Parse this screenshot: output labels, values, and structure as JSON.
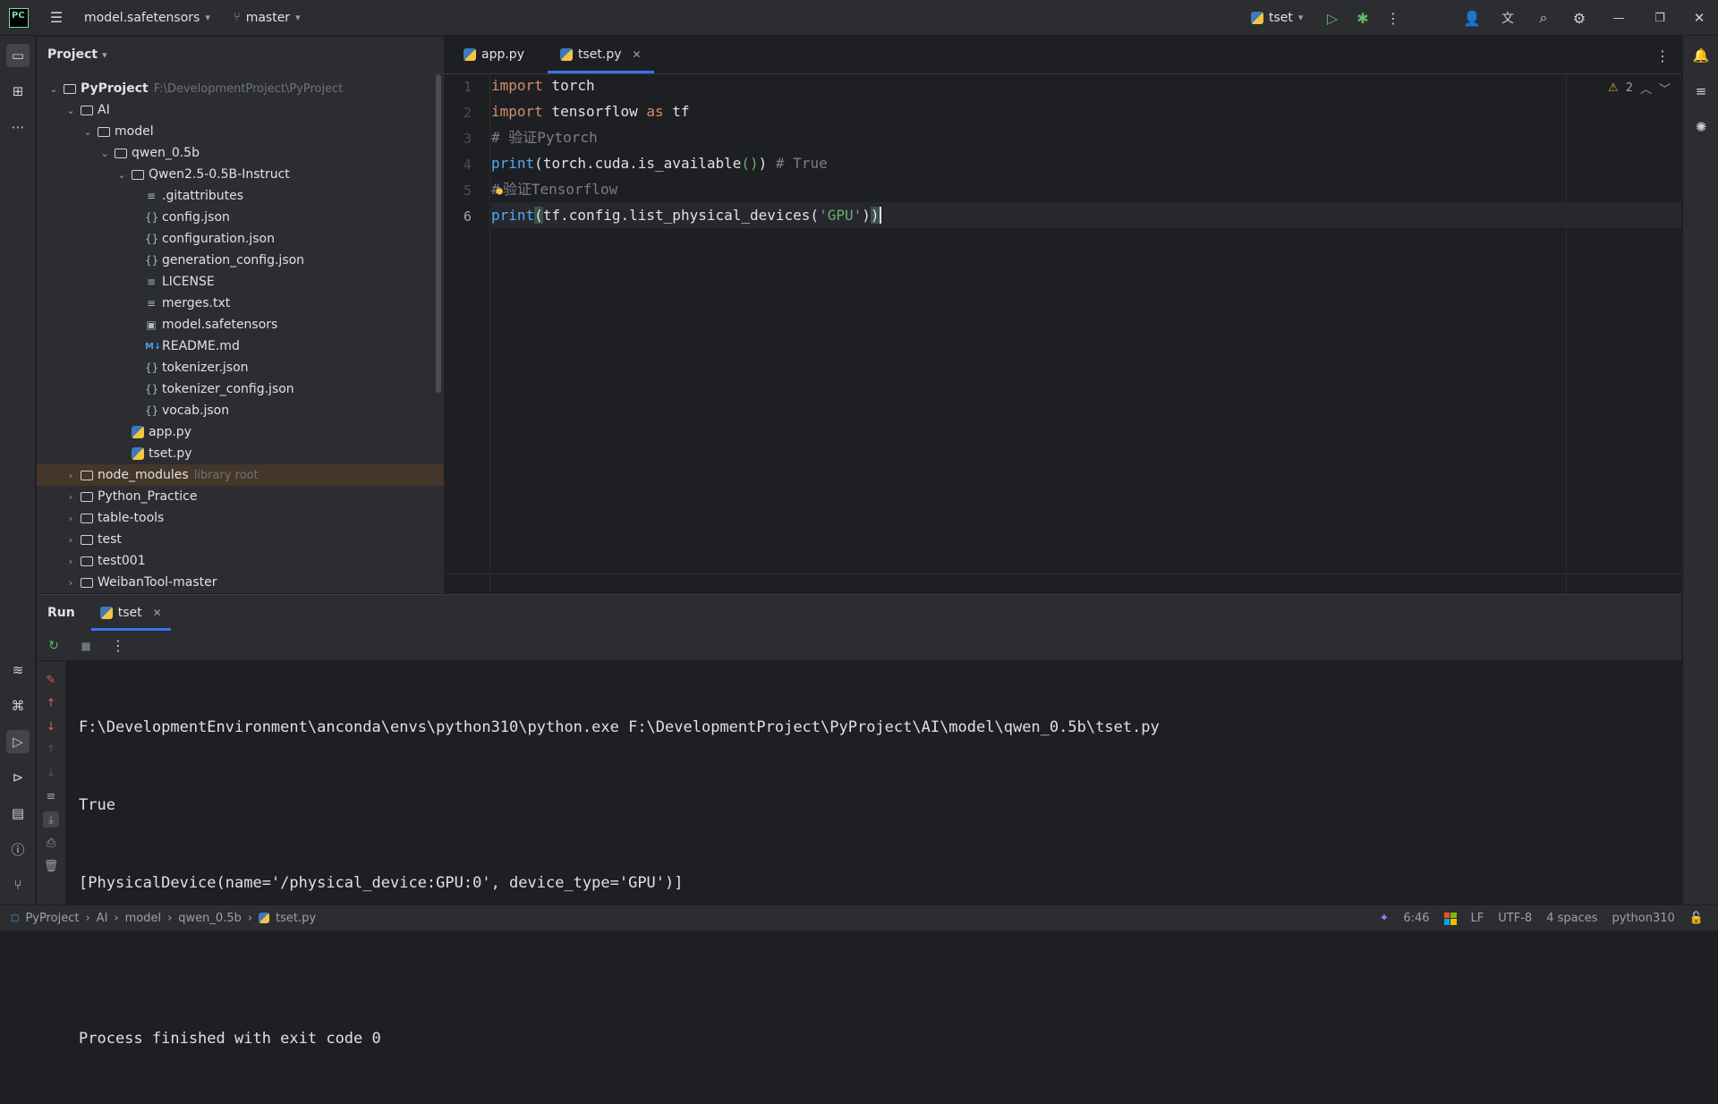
{
  "titlebar": {
    "logo": "PC",
    "project_name": "model.safetensors",
    "branch": "master",
    "run_config": "tset",
    "window_buttons": [
      "minimize",
      "restore",
      "close"
    ]
  },
  "project_panel": {
    "title": "Project",
    "root_name": "PyProject",
    "root_path": "F:\\DevelopmentProject\\PyProject",
    "items": [
      {
        "label": "AI",
        "type": "folder",
        "expanded": true
      },
      {
        "label": "model",
        "type": "folder",
        "expanded": true
      },
      {
        "label": "qwen_0.5b",
        "type": "folder",
        "expanded": true
      },
      {
        "label": "Qwen2.5-0.5B-Instruct",
        "type": "folder",
        "expanded": true
      },
      {
        "label": ".gitattributes",
        "type": "text"
      },
      {
        "label": "config.json",
        "type": "json"
      },
      {
        "label": "configuration.json",
        "type": "json"
      },
      {
        "label": "generation_config.json",
        "type": "json"
      },
      {
        "label": "LICENSE",
        "type": "text"
      },
      {
        "label": "merges.txt",
        "type": "text"
      },
      {
        "label": "model.safetensors",
        "type": "binary"
      },
      {
        "label": "README.md",
        "type": "md"
      },
      {
        "label": "tokenizer.json",
        "type": "json"
      },
      {
        "label": "tokenizer_config.json",
        "type": "json"
      },
      {
        "label": "vocab.json",
        "type": "json"
      },
      {
        "label": "app.py",
        "type": "py"
      },
      {
        "label": "tset.py",
        "type": "py"
      },
      {
        "label": "node_modules",
        "type": "folder",
        "expanded": false,
        "note": "library root"
      },
      {
        "label": "Python_Practice",
        "type": "folder",
        "expanded": false
      },
      {
        "label": "table-tools",
        "type": "folder",
        "expanded": false
      },
      {
        "label": "test",
        "type": "folder",
        "expanded": false
      },
      {
        "label": "test001",
        "type": "folder",
        "expanded": false
      },
      {
        "label": "WeibanTool-master",
        "type": "folder",
        "expanded": false
      }
    ]
  },
  "editor": {
    "tabs": [
      {
        "label": "app.py",
        "active": false
      },
      {
        "label": "tset.py",
        "active": true
      }
    ],
    "warnings": "2",
    "line_numbers": [
      "1",
      "2",
      "3",
      "4",
      "5",
      "6"
    ],
    "code": {
      "l1_kw": "import",
      "l1_rest": " torch",
      "l2_kw": "import",
      "l2_mod": " tensorflow ",
      "l2_as": "as",
      "l2_alias": " tf",
      "l3": "# 验证Pytorch",
      "l4_fn": "print",
      "l4_open": "(",
      "l4_mid": "torch.cuda.is_available",
      "l4_call": "()",
      "l4_close": ")",
      "l4_cm": " # True",
      "l5_hash": "#",
      "l5_rest": "验证Tensorflow",
      "l6_fn": "print",
      "l6_open": "(",
      "l6_mid": "tf.config.list_physical_devices(",
      "l6_str": "'GPU'",
      "l6_close1": ")",
      "l6_close2": ")"
    }
  },
  "run_panel": {
    "title": "Run",
    "tab": "tset",
    "output": [
      "F:\\DevelopmentEnvironment\\anconda\\envs\\python310\\python.exe F:\\DevelopmentProject\\PyProject\\AI\\model\\qwen_0.5b\\tset.py",
      "True",
      "[PhysicalDevice(name='/physical_device:GPU:0', device_type='GPU')]",
      "",
      "Process finished with exit code 0"
    ]
  },
  "statusbar": {
    "breadcrumbs": [
      "PyProject",
      "AI",
      "model",
      "qwen_0.5b",
      "tset.py"
    ],
    "position": "6:46",
    "line_sep": "LF",
    "encoding": "UTF-8",
    "indent": "4 spaces",
    "interpreter": "python310"
  }
}
